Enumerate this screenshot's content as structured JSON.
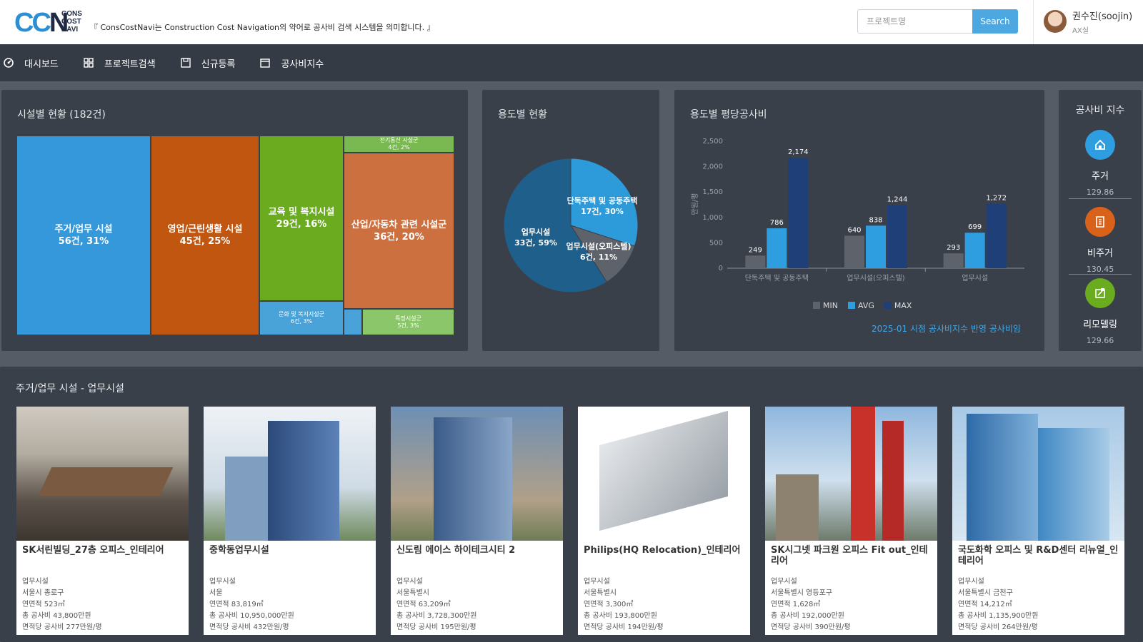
{
  "header": {
    "logo_main": "CCN",
    "logo_small": [
      "CONS",
      "COST",
      "NAVI"
    ],
    "tagline": "『 ConsCostNavi는 Construction Cost Navigation의 약어로 공사비 검색 시스템을 의미합니다. 』",
    "search_placeholder": "프로젝트명",
    "search_button": "Search",
    "user_name": "권수진(soojin)",
    "user_dept": "AX실"
  },
  "nav": {
    "items": [
      {
        "label": "대시보드",
        "icon": "dashboard-icon"
      },
      {
        "label": "프로젝트검색",
        "icon": "grid-icon"
      },
      {
        "label": "신규등록",
        "icon": "save-icon"
      },
      {
        "label": "공사비지수",
        "icon": "calendar-icon"
      }
    ]
  },
  "facility": {
    "title": "시설별 현황 (182건)",
    "cells": [
      {
        "label": "주거/업무 시설",
        "sub": "56건, 31%",
        "color": "#3498db"
      },
      {
        "label": "영업/근린생활 시설",
        "sub": "45건, 25%",
        "color": "#c0560f"
      },
      {
        "label": "교육 및 복지시설",
        "sub": "29건, 16%",
        "color": "#6aab1f"
      },
      {
        "label": "산업/자동차 관련 시설군",
        "sub": "36건, 20%",
        "color": "#cc7040"
      },
      {
        "label": "전기통신 시설군",
        "sub": "4건, 2%",
        "color": "#7ab851"
      },
      {
        "label": "문화 및 복지지설군",
        "sub": "6건, 3%",
        "color": "#4aa3d8"
      },
      {
        "label": "특정시설군",
        "sub": "5건, 3%",
        "color": "#8cc66a"
      }
    ]
  },
  "usage": {
    "title": "용도별 현황",
    "slices": [
      {
        "label": "단독주택 및 공동주택",
        "sub": "17건, 30%",
        "value": 30,
        "color": "#2d9ad9"
      },
      {
        "label": "업무시설(오피스텔)",
        "sub": "6건, 11%",
        "value": 11,
        "color": "#5e636b"
      },
      {
        "label": "업무시설",
        "sub": "33건, 59%",
        "value": 59,
        "color": "#1f5f8c"
      }
    ]
  },
  "chart_data": {
    "type": "bar",
    "title": "용도별 평당공사비",
    "ylabel": "만원/평",
    "categories": [
      "단독주택 및 공동주택",
      "업무시설(오피스텔)",
      "업무시설"
    ],
    "series": [
      {
        "name": "MIN",
        "values": [
          249,
          640,
          293
        ],
        "color": "#5e636b"
      },
      {
        "name": "AVG",
        "values": [
          786,
          838,
          699
        ],
        "color": "#2f9ee0"
      },
      {
        "name": "MAX",
        "values": [
          2174,
          1244,
          1272
        ],
        "color": "#1f3f78"
      }
    ],
    "yticks": [
      0,
      500,
      1000,
      1500,
      2000,
      2500
    ],
    "ylim": [
      0,
      2500
    ],
    "legend": "bottom",
    "note": "2025-01 시점 공사비지수 반영 공사비임"
  },
  "index": {
    "title": "공사비 지수",
    "items": [
      {
        "label": "주거",
        "value": "129.86",
        "color": "#2f9ee0",
        "icon": "house-icon"
      },
      {
        "label": "비주거",
        "value": "130.45",
        "color": "#d9621a",
        "icon": "building-icon"
      },
      {
        "label": "리모델링",
        "value": "129.66",
        "color": "#6aab1f",
        "icon": "remodel-icon"
      }
    ]
  },
  "projects": {
    "title": "주거/업무 시설 - 업무시설",
    "cards": [
      {
        "title": "SK서린빌딩_27층 오피스_인테리어",
        "type": "업무시설",
        "location": "서울시 종로구",
        "area": "연면적 523㎡",
        "total": "총 공사비 43,800만원",
        "per": "면적당 공사비 277만원/평"
      },
      {
        "title": "중학동업무시설",
        "type": "업무시설",
        "location": "서울",
        "area": "연면적 83,819㎡",
        "total": "총 공사비 10,950,000만원",
        "per": "면적당 공사비 432만원/평"
      },
      {
        "title": "신도림 에이스 하이테크시티 2",
        "type": "업무시설",
        "location": "서울특별시",
        "area": "연면적 63,209㎡",
        "total": "총 공사비 3,728,300만원",
        "per": "면적당 공사비 195만원/평"
      },
      {
        "title": "Philips(HQ Relocation)_인테리어",
        "type": "업무시설",
        "location": "서울특별시",
        "area": "연면적 3,300㎡",
        "total": "총 공사비 193,800만원",
        "per": "면적당 공사비 194만원/평"
      },
      {
        "title": "SK시그넷 파크원 오피스 Fit out_인테리어",
        "type": "업무시설",
        "location": "서울특별시 영등포구",
        "area": "연면적 1,628㎡",
        "total": "총 공사비 192,000만원",
        "per": "면적당 공사비 390만원/평"
      },
      {
        "title": "국도화학 오피스 및 R&D센터 리뉴얼_인테리어",
        "type": "업무시설",
        "location": "서울특별시 금천구",
        "area": "연면적 14,212㎡",
        "total": "총 공사비 1,135,900만원",
        "per": "면적당 공사비 264만원/평"
      }
    ]
  }
}
